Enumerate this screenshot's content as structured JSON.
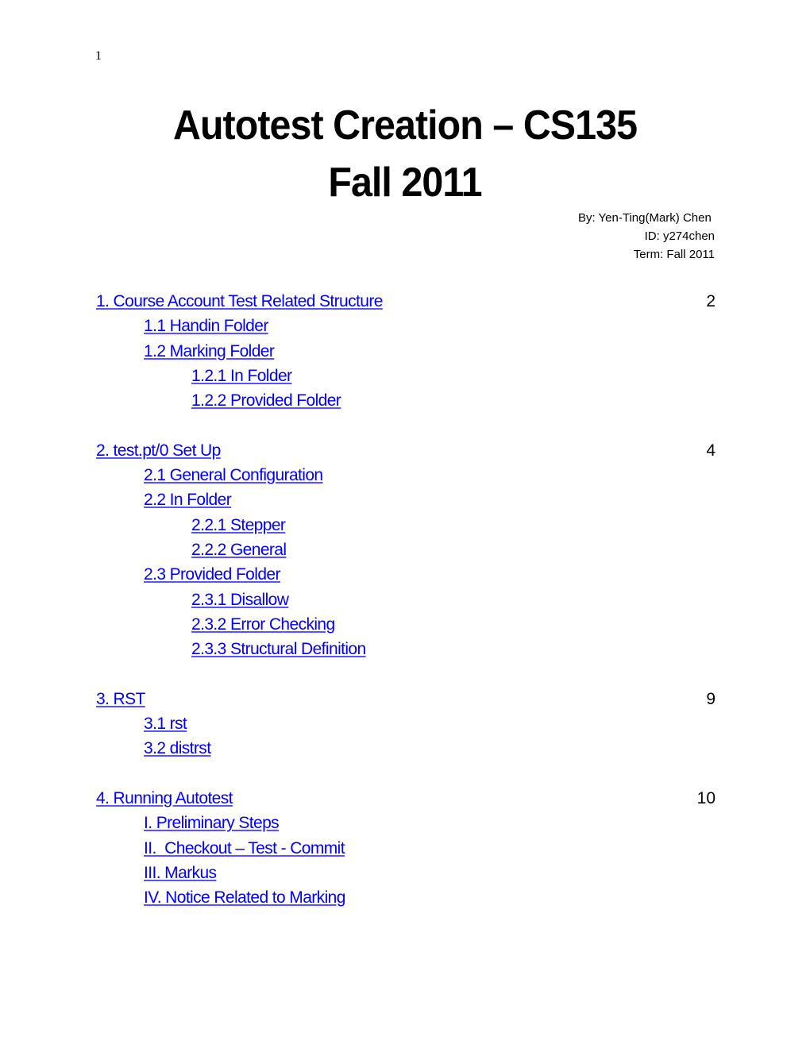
{
  "page_number": "1",
  "title": {
    "line1": "Autotest Creation – CS135",
    "line2": "Fall 2011"
  },
  "author": {
    "by": "By: Yen-Ting(Mark) Chen ",
    "id": "ID: y274chen",
    "term": "Term: Fall 2011"
  },
  "toc": {
    "link_color": "#0000ff",
    "sections": [
      {
        "label": "1. Course Account Test Related Structure",
        "page": "2",
        "children": [
          {
            "label": "1.1 Handin Folder",
            "level": 1
          },
          {
            "label": "1.2 Marking Folder",
            "level": 1
          },
          {
            "label": "1.2.1 In Folder",
            "level": 2
          },
          {
            "label": "1.2.2 Provided Folder",
            "level": 2
          }
        ]
      },
      {
        "label": "2. test.pt/0 Set Up",
        "page": "4",
        "children": [
          {
            "label": "2.1 General Configuration",
            "level": 1
          },
          {
            "label": "2.2 In Folder",
            "level": 1
          },
          {
            "label": "2.2.1 Stepper",
            "level": 2
          },
          {
            "label": "2.2.2 General",
            "level": 2
          },
          {
            "label": "2.3 Provided Folder",
            "level": 1
          },
          {
            "label": "2.3.1 Disallow",
            "level": 2
          },
          {
            "label": "2.3.2 Error Checking",
            "level": 2
          },
          {
            "label": "2.3.3 Structural Definition",
            "level": 2
          }
        ]
      },
      {
        "label": "3. RST",
        "page": "9",
        "children": [
          {
            "label": "3.1 rst",
            "level": 1
          },
          {
            "label": "3.2 distrst",
            "level": 1
          }
        ]
      },
      {
        "label": "4. Running Autotest",
        "page": "10",
        "children": [
          {
            "label": "I. Preliminary Steps",
            "level": 1
          },
          {
            "label": "II.  Checkout – Test - Commit",
            "level": 1
          },
          {
            "label": "III. Markus",
            "level": 1
          },
          {
            "label": "IV. Notice Related to Marking",
            "level": 1
          }
        ]
      }
    ]
  }
}
